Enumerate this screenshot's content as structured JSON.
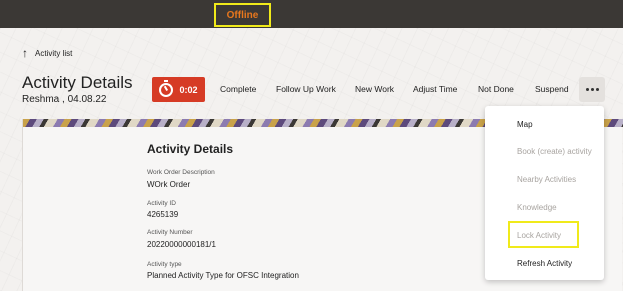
{
  "status": {
    "offline_label": "Offline"
  },
  "nav": {
    "back_label": "Activity list",
    "back_icon": "arrow-up-icon"
  },
  "header": {
    "title": "Activity Details",
    "subtitle": "Reshma   , 04.08.22"
  },
  "toolbar": {
    "timer_label": "0:02",
    "timer_color": "#d63b25",
    "actions": [
      "Complete",
      "Follow Up Work",
      "New Work",
      "Adjust Time",
      "Not Done",
      "Suspend"
    ],
    "more_icon": "more-horizontal-icon"
  },
  "details": {
    "section_title": "Activity Details",
    "fields": [
      {
        "label": "Work Order Description",
        "value": "WOrk Order"
      },
      {
        "label": "Activity ID",
        "value": "4265139"
      },
      {
        "label": "Activity Number",
        "value": "20220000000181/1"
      },
      {
        "label": "Activity type",
        "value": "Planned Activity Type for OFSC Integration"
      }
    ]
  },
  "more_menu": {
    "items": [
      {
        "label": "Map",
        "enabled": true
      },
      {
        "label": "Book (create) activity",
        "enabled": false
      },
      {
        "label": "Nearby Activities",
        "enabled": false
      },
      {
        "label": "Knowledge",
        "enabled": false
      },
      {
        "label": "Lock Activity",
        "enabled": false
      },
      {
        "label": "Refresh Activity",
        "enabled": true
      }
    ]
  },
  "colors": {
    "topbar": "#3b3835",
    "highlight": "#f0ea1a",
    "offline_text": "#e8771d"
  }
}
